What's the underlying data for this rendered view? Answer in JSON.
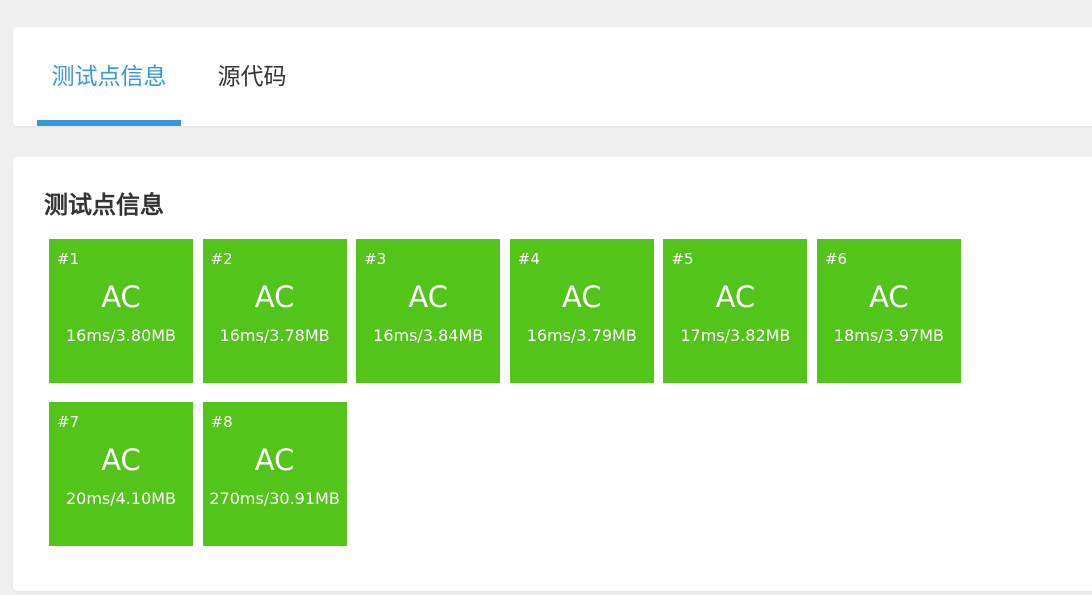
{
  "tabs": [
    {
      "label": "测试点信息",
      "active": true
    },
    {
      "label": "源代码",
      "active": false
    }
  ],
  "section": {
    "title": "测试点信息"
  },
  "colors": {
    "accent": "#3498db",
    "ac": "#52c41a"
  },
  "cases": [
    {
      "id": "#1",
      "status": "AC",
      "usage": "16ms/3.80MB"
    },
    {
      "id": "#2",
      "status": "AC",
      "usage": "16ms/3.78MB"
    },
    {
      "id": "#3",
      "status": "AC",
      "usage": "16ms/3.84MB"
    },
    {
      "id": "#4",
      "status": "AC",
      "usage": "16ms/3.79MB"
    },
    {
      "id": "#5",
      "status": "AC",
      "usage": "17ms/3.82MB"
    },
    {
      "id": "#6",
      "status": "AC",
      "usage": "18ms/3.97MB"
    },
    {
      "id": "#7",
      "status": "AC",
      "usage": "20ms/4.10MB"
    },
    {
      "id": "#8",
      "status": "AC",
      "usage": "270ms/30.91MB"
    }
  ]
}
